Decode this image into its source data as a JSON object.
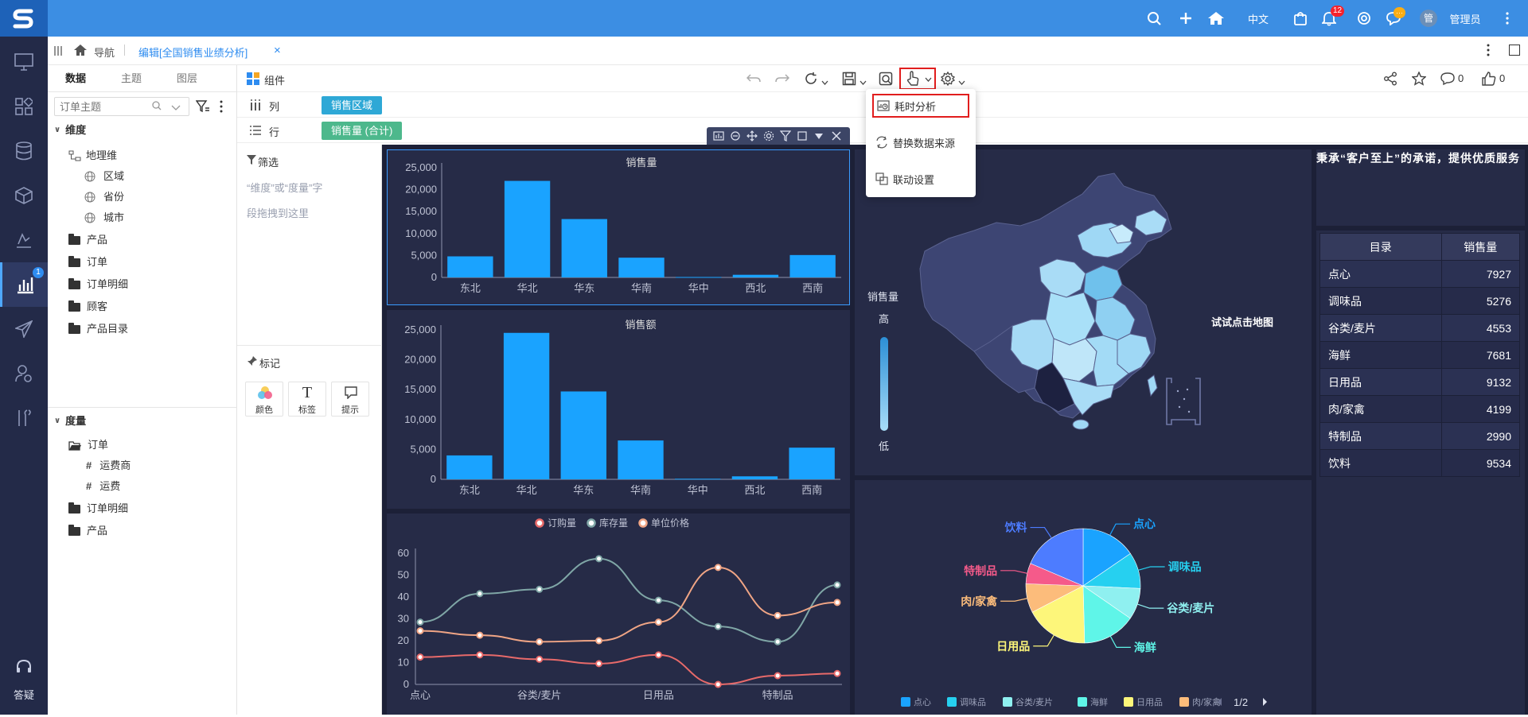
{
  "topbar": {
    "language": "中文",
    "notification_count": "12",
    "chat_badge": "···",
    "avatar_text": "管",
    "user_name": "管理员"
  },
  "rail": {
    "active_badge": "1",
    "help_label": "答疑"
  },
  "tabs": {
    "nav_label": "导航",
    "edit_tab_label": "编辑[全国销售业绩分析]"
  },
  "left_panel": {
    "tabs": [
      "数据",
      "主题",
      "图层"
    ],
    "search_placeholder": "订单主题",
    "dimension_header": "维度",
    "geo_dim": "地理维",
    "geo_items": [
      "区域",
      "省份",
      "城市"
    ],
    "dim_folders": [
      "产品",
      "订单",
      "订单明细",
      "顾客",
      "产品目录"
    ],
    "measure_header": "度量",
    "measure_folder": "订单",
    "measure_items": [
      "运费商",
      "运费"
    ],
    "measure_folders": [
      "订单明细",
      "产品"
    ]
  },
  "toolbar": {
    "component_label": "组件",
    "comment_count": "0",
    "like_count": "0"
  },
  "shelves": {
    "col_label": "列",
    "col_pill": "销售区域",
    "row_label": "行",
    "row_pill": "销售量 (合计)"
  },
  "mid_panel": {
    "filter_label": "筛选",
    "filter_hint_1": "“维度”或“度量”字",
    "filter_hint_2": "段拖拽到这里",
    "mark_label": "标记",
    "mark_buttons": [
      "颜色",
      "标签",
      "提示"
    ]
  },
  "popup": {
    "items": [
      "耗时分析",
      "替换数据来源",
      "联动设置"
    ]
  },
  "chart_data": [
    {
      "type": "bar",
      "title": "销售量",
      "categories": [
        "东北",
        "华北",
        "华东",
        "华南",
        "华中",
        "西北",
        "西南"
      ],
      "values": [
        4800,
        22000,
        13300,
        4500,
        100,
        600,
        5100
      ],
      "ylim": [
        0,
        25000
      ],
      "yticks": [
        "0",
        "5,000",
        "10,000",
        "15,000",
        "20,000",
        "25,000"
      ],
      "color": "#1aa3ff"
    },
    {
      "type": "bar",
      "title": "销售额",
      "categories": [
        "东北",
        "华北",
        "华东",
        "华南",
        "华中",
        "西北",
        "西南"
      ],
      "values": [
        4000,
        24500,
        14700,
        6500,
        100,
        500,
        5300
      ],
      "ylim": [
        0,
        25000
      ],
      "yticks": [
        "0",
        "5,000",
        "10,000",
        "15,000",
        "20,000",
        "25,000"
      ],
      "color": "#1aa3ff"
    },
    {
      "type": "line",
      "categories": [
        "点心",
        "调味品",
        "谷类/麦片",
        "海鲜",
        "日用品",
        "肉/家禽",
        "特制品",
        "饮料"
      ],
      "xtick_labels": [
        "点心",
        "谷类/麦片",
        "日用品",
        "特制品"
      ],
      "ylim": [
        0,
        60
      ],
      "yticks": [
        "0",
        "10",
        "20",
        "30",
        "40",
        "50",
        "60"
      ],
      "legend_position": "top",
      "series": [
        {
          "name": "订购量",
          "color": "#e86a6a",
          "values": [
            12.5,
            13.5,
            11.5,
            9.5,
            13.5,
            0,
            4,
            5
          ]
        },
        {
          "name": "库存量",
          "color": "#7fa6a6",
          "values": [
            28.5,
            41.5,
            43.5,
            57.5,
            38.5,
            26.5,
            19.5,
            45.5
          ]
        },
        {
          "name": "单位价格",
          "color": "#f0a585",
          "values": [
            24.5,
            22.5,
            19.5,
            20,
            28.5,
            53.5,
            31.5,
            37.5
          ]
        }
      ]
    },
    {
      "type": "pie",
      "categories": [
        "点心",
        "调味品",
        "谷类/麦片",
        "海鲜",
        "日用品",
        "肉/家禽",
        "特制品",
        "饮料"
      ],
      "values": [
        7927,
        5276,
        4553,
        7681,
        9132,
        4199,
        2990,
        9534
      ],
      "colors": [
        "#1aa3ff",
        "#26d0f0",
        "#8ff0f0",
        "#5ff5e8",
        "#fdf67a",
        "#fcbc7b",
        "#f55a8a",
        "#4d7cff"
      ],
      "legend_page": "1/2",
      "legend_visible": [
        "点心",
        "调味品",
        "谷类/麦片",
        "海鲜",
        "日用品",
        "肉/家禽"
      ]
    }
  ],
  "map": {
    "legend_title": "销售量",
    "legend_high": "高",
    "legend_low": "低",
    "hint": "试试点击地图"
  },
  "slogan": "秉承“客户至上”的承诺，提供优质服务",
  "table": {
    "headers": [
      "目录",
      "销售量"
    ],
    "rows": [
      [
        "点心",
        "7927"
      ],
      [
        "调味品",
        "5276"
      ],
      [
        "谷类/麦片",
        "4553"
      ],
      [
        "海鲜",
        "7681"
      ],
      [
        "日用品",
        "9132"
      ],
      [
        "肉/家禽",
        "4199"
      ],
      [
        "特制品",
        "2990"
      ],
      [
        "饮料",
        "9534"
      ]
    ]
  }
}
